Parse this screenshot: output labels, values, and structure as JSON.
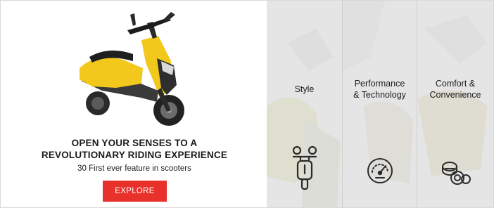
{
  "promo": {
    "headline_line1": "OPEN YOUR SENSES TO A",
    "headline_line2": "REVOLUTIONARY RIDING EXPERIENCE",
    "subline": "30 First ever feature in scooters",
    "cta_label": "EXPLORE",
    "cta_color": "#e8312a",
    "scooter_color": "#f2c81c"
  },
  "features": [
    {
      "line1": "Style",
      "line2": "",
      "icon": "scooter-front-icon"
    },
    {
      "line1": "Performance",
      "line2": "& Technology",
      "icon": "speedometer-icon"
    },
    {
      "line1": "Comfort &",
      "line2": "Convenience",
      "icon": "bearing-icon"
    }
  ]
}
